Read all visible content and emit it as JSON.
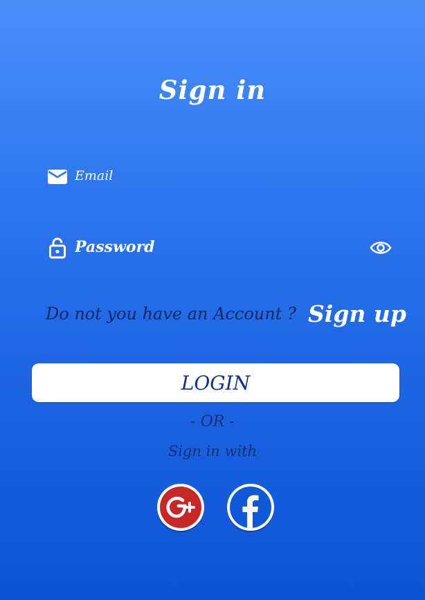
{
  "title": "Sign in",
  "email_field": {
    "placeholder": "Email",
    "icon": "mail-icon"
  },
  "password_field": {
    "placeholder": "Password",
    "icon": "lock-icon",
    "toggle_icon": "eye-icon"
  },
  "account_prompt": "Do not you have an Account ?",
  "signup_label": "Sign up",
  "login_label": "LOGIN",
  "or_label": "- OR -",
  "signin_with_label": "Sign in with",
  "social": [
    {
      "name": "google-plus-icon",
      "color": "#c62828"
    },
    {
      "name": "facebook-icon",
      "color": "#1059d6"
    }
  ],
  "colors": {
    "background_top": "#4a8ff8",
    "background_bottom": "#0c54d6",
    "prompt_text": "#0b2a63",
    "button_text": "#0d2f9a",
    "button_bg": "#ffffff"
  }
}
